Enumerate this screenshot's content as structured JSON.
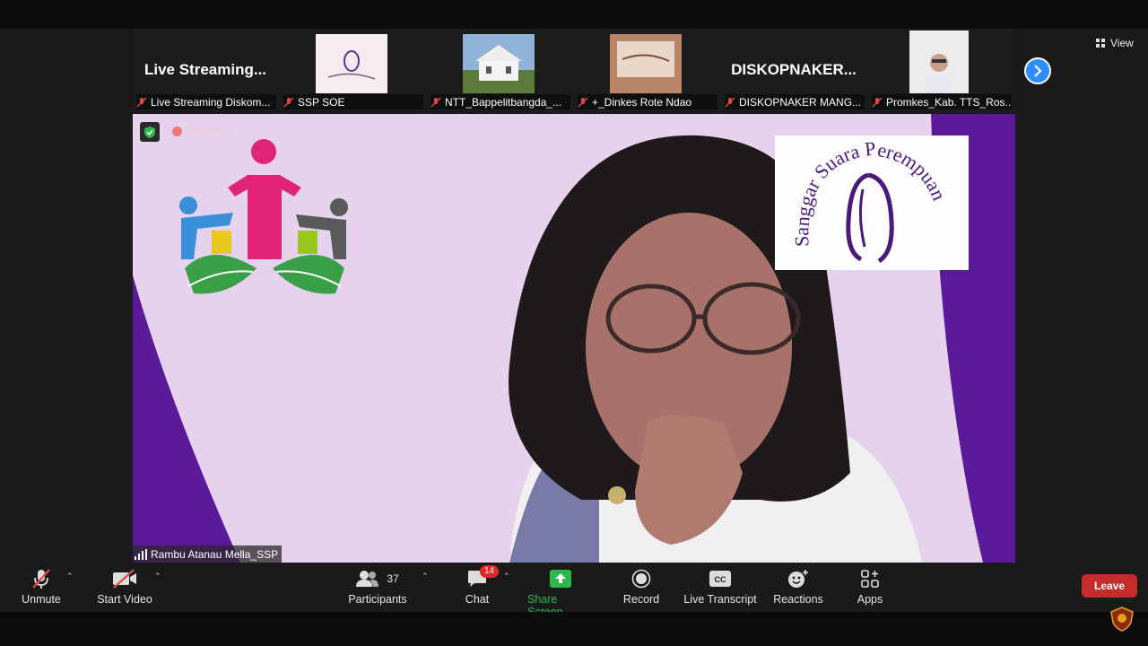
{
  "strip": {
    "tiles": [
      {
        "title": "Live  Streaming...",
        "label": "Live Streaming Diskom..."
      },
      {
        "title": "",
        "label": "SSP SOE"
      },
      {
        "title": "",
        "label": "NTT_Bappelitbangda_..."
      },
      {
        "title": "",
        "label": "+_Dinkes Rote Ndao"
      },
      {
        "title": "DISKOPNAKER...",
        "label": "DISKOPNAKER MANG..."
      },
      {
        "title": "",
        "label": "Promkes_Kab. TTS_Ros..."
      }
    ],
    "view_label": "View"
  },
  "main": {
    "recording_label": "Recording",
    "speaker_name": "Rambu Atanau Mella_SSP",
    "logo_text": "Sanggar Suara Perempuan"
  },
  "toolbar": {
    "unmute": "Unmute",
    "start_video": "Start Video",
    "participants": "Participants",
    "participants_count": "37",
    "chat": "Chat",
    "chat_badge": "14",
    "share_screen": "Share Screen",
    "record": "Record",
    "live_transcript": "Live Transcript",
    "reactions": "Reactions",
    "apps": "Apps",
    "leave": "Leave"
  },
  "colors": {
    "accent_blue": "#2d8cff",
    "share_green": "#2db84d",
    "leave_red": "#c42b2b",
    "badge_red": "#e02828",
    "background_purple": "#5a1a9a",
    "background_lilac": "#e6d2ec"
  },
  "icons": [
    "mic-off-icon",
    "video-off-icon",
    "participants-icon",
    "chat-icon",
    "share-screen-icon",
    "record-icon",
    "cc-icon",
    "reactions-icon",
    "apps-icon",
    "shield-icon",
    "chevron-right-icon",
    "grid-view-icon"
  ]
}
